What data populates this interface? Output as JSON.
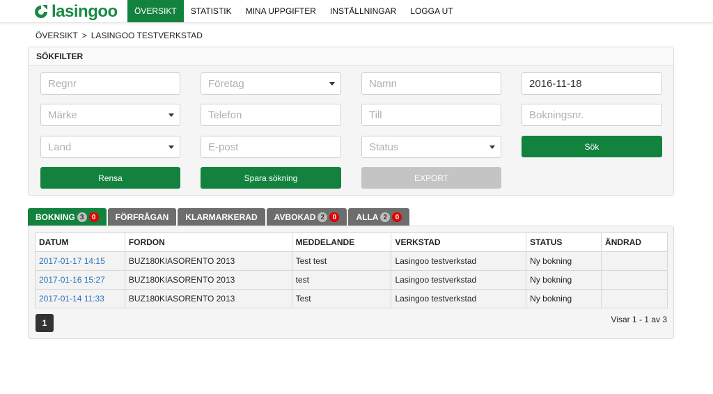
{
  "brand": {
    "name": "lasingoo",
    "color": "#13823f"
  },
  "nav": {
    "items": [
      {
        "label": "ÖVERSIKT",
        "active": true
      },
      {
        "label": "STATISTIK"
      },
      {
        "label": "MINA UPPGIFTER"
      },
      {
        "label": "INSTÄLLNINGAR"
      },
      {
        "label": "LOGGA UT"
      }
    ]
  },
  "breadcrumb": {
    "root": "ÖVERSIKT",
    "separator": ">",
    "current": "LASINGOO TESTVERKSTAD"
  },
  "search": {
    "title": "SÖKFILTER",
    "regnr_placeholder": "Regnr",
    "foretag_placeholder": "Företag",
    "namn_placeholder": "Namn",
    "date_value": "2016-11-18",
    "marke_placeholder": "Märke",
    "telefon_placeholder": "Telefon",
    "till_placeholder": "Till",
    "bokningsnr_placeholder": "Bokningsnr.",
    "land_placeholder": "Land",
    "epost_placeholder": "E-post",
    "status_placeholder": "Status",
    "search_label": "Sök",
    "clear_label": "Rensa",
    "save_label": "Spara sökning",
    "export_label": "EXPORT"
  },
  "tabs": [
    {
      "label": "BOKNING",
      "count": "3",
      "new": "0",
      "active": true
    },
    {
      "label": "FÖRFRÅGAN"
    },
    {
      "label": "KLARMARKERAD"
    },
    {
      "label": "AVBOKAD",
      "count": "2",
      "new": "0"
    },
    {
      "label": "ALLA",
      "count": "2",
      "new": "0"
    }
  ],
  "table": {
    "columns": [
      "DATUM",
      "FORDON",
      "MEDDELANDE",
      "VERKSTAD",
      "STATUS",
      "ÄNDRAD"
    ],
    "rows": [
      [
        "2017-01-17 14:15",
        "BUZ180KIASORENTO 2013",
        "Test test",
        "Lasingoo testverkstad",
        "Ny bokning",
        ""
      ],
      [
        "2017-01-16 15:27",
        "BUZ180KIASORENTO 2013",
        "test",
        "Lasingoo testverkstad",
        "Ny bokning",
        ""
      ],
      [
        "2017-01-14 11:33",
        "BUZ180KIASORENTO 2013",
        "Test",
        "Lasingoo testverkstad",
        "Ny bokning",
        ""
      ]
    ]
  },
  "pager": {
    "current_page": "1",
    "showing": "Visar 1 - 1 av 3"
  }
}
